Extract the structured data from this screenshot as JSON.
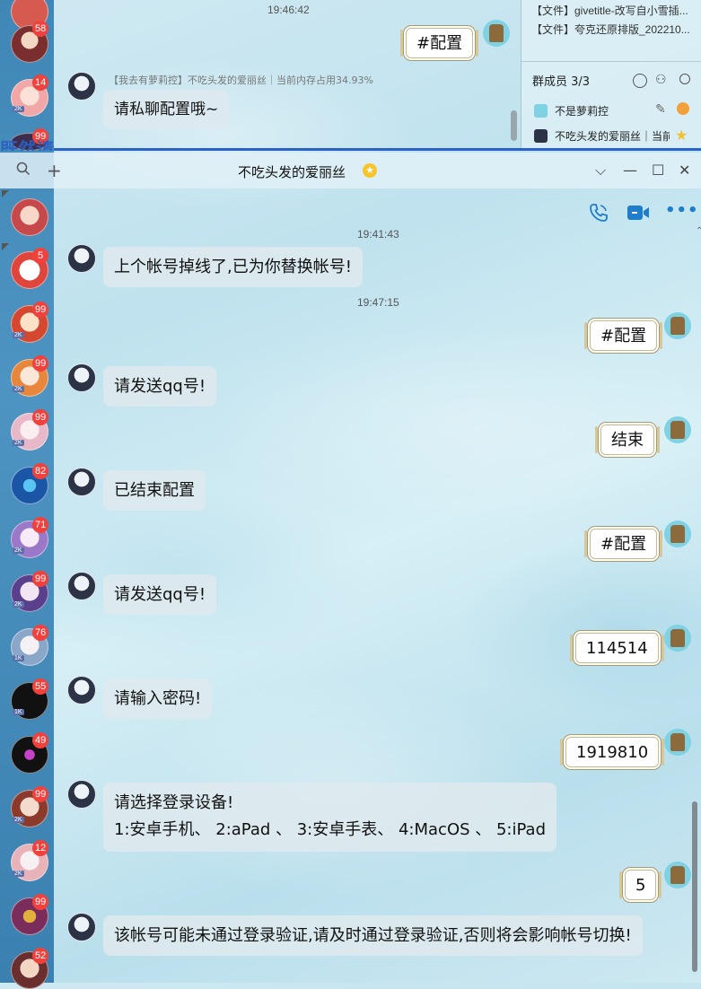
{
  "sidebar": {
    "badges": [
      "58",
      "14",
      "99",
      "5",
      "99",
      "99",
      "99",
      "82",
      "71",
      "99",
      "76",
      "55",
      "49",
      "99",
      "12",
      "99",
      "52"
    ],
    "tags": [
      "2K",
      "2K",
      "2K",
      "2K",
      "2K",
      "2K",
      "1K",
      "1K",
      "2K",
      "2K"
    ]
  },
  "background_window": {
    "time": "19:46:42",
    "files": [
      "【文件】givetitle-改写自小雪插...",
      "【文件】夸克还原排版_202210..."
    ],
    "members_title": "群成员 3/3",
    "members": [
      "不是萝莉控",
      "不吃头发的爱丽丝｜当前"
    ],
    "sent_message": "#配置",
    "sender_line": "【我去有萝莉控】不吃头发的爱丽丝｜当前内存占用34.93%",
    "reply_message": "请私聊配置哦~",
    "ghost_text": "既然请看"
  },
  "titlebar": {
    "title": "不吃头发的爱丽丝",
    "search_icon": "search-icon",
    "add_icon": "plus-icon",
    "dropdown": "⌵",
    "minimize": "—",
    "maximize": "☐",
    "close": "✕"
  },
  "chat_actions": {
    "phone": "phone-icon",
    "video": "video-icon",
    "more": "•••"
  },
  "messages": {
    "t1": "19:41:43",
    "m1": "上个帐号掉线了,已为你替换帐号!",
    "t2": "19:47:15",
    "m2": "#配置",
    "m3": "请发送qq号!",
    "m4": "结束",
    "m5": "已结束配置",
    "m6": "#配置",
    "m7": "请发送qq号!",
    "m8": "114514",
    "m9": "请输入密码!",
    "m10": "1919810",
    "m11_line1": "请选择登录设备!",
    "m11_line2": "1:安卓手机、 2:aPad 、 3:安卓手表、 4:MacOS 、 5:iPad",
    "m12": "5",
    "m13": "该帐号可能未通过登录验证,请及时通过登录验证,否则将会影响帐号切换!"
  },
  "colors": {
    "sidebar": "#4089b8",
    "badge": "#f0413c",
    "accent": "#1f7ecb"
  }
}
